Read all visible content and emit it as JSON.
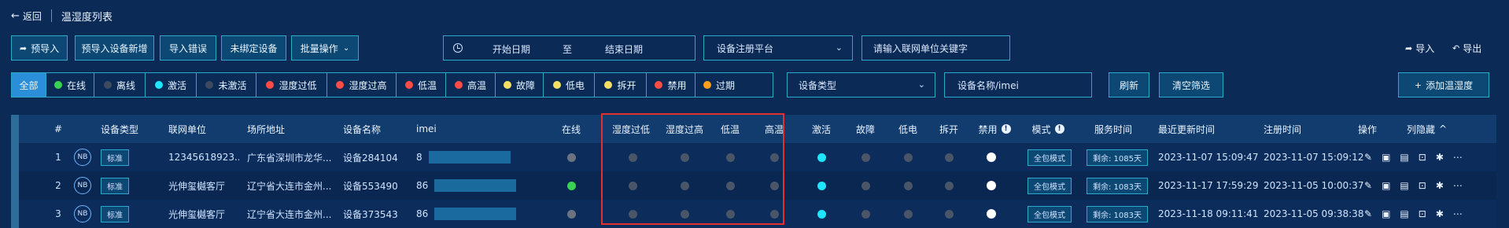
{
  "header": {
    "back_label": "返回",
    "title": "温湿度列表"
  },
  "toolbar": {
    "pre_import": "预导入",
    "pre_import_add": "预导入设备新增",
    "import_error": "导入错误",
    "unbound_device": "未绑定设备",
    "batch_ops": "批量操作",
    "start_date": "开始日期",
    "date_to": "至",
    "end_date": "结束日期",
    "platform_placeholder": "设备注册平台",
    "unit_placeholder": "请输入联网单位关键字",
    "import": "导入",
    "export": "导出"
  },
  "filters": {
    "chips": [
      {
        "label": "全部",
        "dot_color": ""
      },
      {
        "label": "在线",
        "dot_color": "#39d353"
      },
      {
        "label": "离线",
        "dot_color": "#3e4a5e"
      },
      {
        "label": "激活",
        "dot_color": "#1fe6ff"
      },
      {
        "label": "未激活",
        "dot_color": "#3e4a5e"
      },
      {
        "label": "湿度过低",
        "dot_color": "#ff4b45"
      },
      {
        "label": "湿度过高",
        "dot_color": "#ff4b45"
      },
      {
        "label": "低温",
        "dot_color": "#ff4b45"
      },
      {
        "label": "高温",
        "dot_color": "#ff4b45"
      },
      {
        "label": "故障",
        "dot_color": "#f4df65"
      },
      {
        "label": "低电",
        "dot_color": "#f4df65"
      },
      {
        "label": "拆开",
        "dot_color": "#f4df65"
      },
      {
        "label": "禁用",
        "dot_color": "#ff4b45"
      },
      {
        "label": "过期",
        "dot_color": "#ff9f1a"
      }
    ],
    "device_type_placeholder": "设备类型",
    "device_name_placeholder": "设备名称/imei",
    "refresh": "刷新",
    "clear": "清空筛选",
    "add_device": "添加温湿度"
  },
  "table": {
    "headers": {
      "no": "#",
      "type": "设备类型",
      "unit": "联网单位",
      "address": "场所地址",
      "name": "设备名称",
      "imei": "imei",
      "online": "在线",
      "hum_low": "湿度过低",
      "hum_high": "湿度过高",
      "temp_low": "低温",
      "temp_high": "高温",
      "active": "激活",
      "fault": "故障",
      "low_power": "低电",
      "opened": "拆开",
      "disabled": "禁用",
      "mode": "模式",
      "service": "服务时间",
      "last_update": "最近更新时间",
      "register": "注册时间",
      "actions": "操作",
      "hide_cols": "列隐藏"
    },
    "rows": [
      {
        "no": "1",
        "type_badge": "NB",
        "type_tag": "标准",
        "unit": "12345618923...",
        "address": "广东省深圳市龙华...",
        "name": "设备284104",
        "imei_prefix": "8",
        "online": "#6c7482",
        "mode": "全包模式",
        "service": "剩余: 1085天",
        "last_update": "2023-11-07 15:09:47",
        "register": "2023-11-07 15:09:12"
      },
      {
        "no": "2",
        "type_badge": "NB",
        "type_tag": "标准",
        "unit": "光伸玺樾客厅",
        "address": "辽宁省大连市金州...",
        "name": "设备553490",
        "imei_prefix": "86",
        "online": "#39d353",
        "mode": "全包模式",
        "service": "剩余: 1083天",
        "last_update": "2023-11-17 17:59:29",
        "register": "2023-11-05 10:00:37"
      },
      {
        "no": "3",
        "type_badge": "NB",
        "type_tag": "标准",
        "unit": "光伸玺樾客厅",
        "address": "辽宁省大连市金州...",
        "name": "设备373543",
        "imei_prefix": "86",
        "online": "#6c7482",
        "mode": "全包模式",
        "service": "剩余: 1083天",
        "last_update": "2023-11-18 09:11:41",
        "register": "2023-11-05 09:38:38"
      }
    ],
    "colors": {
      "off": "#4a5568",
      "active": "#1fe6ff",
      "disabled": "#ffffff"
    }
  }
}
